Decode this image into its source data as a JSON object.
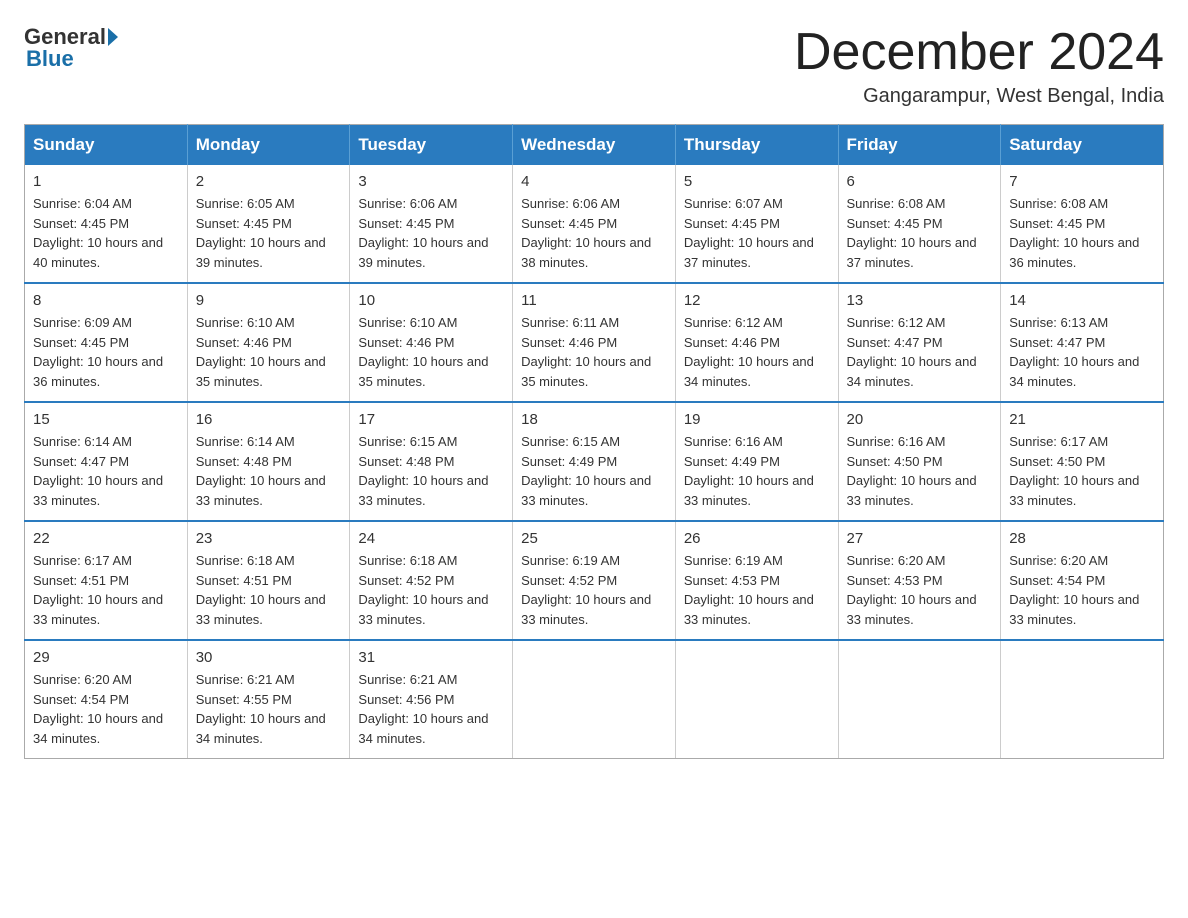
{
  "logo": {
    "general": "General",
    "blue": "Blue",
    "arrow": "▶"
  },
  "header": {
    "title": "December 2024",
    "location": "Gangarampur, West Bengal, India"
  },
  "days": [
    "Sunday",
    "Monday",
    "Tuesday",
    "Wednesday",
    "Thursday",
    "Friday",
    "Saturday"
  ],
  "weeks": [
    [
      {
        "num": "1",
        "sunrise": "6:04 AM",
        "sunset": "4:45 PM",
        "daylight": "10 hours and 40 minutes."
      },
      {
        "num": "2",
        "sunrise": "6:05 AM",
        "sunset": "4:45 PM",
        "daylight": "10 hours and 39 minutes."
      },
      {
        "num": "3",
        "sunrise": "6:06 AM",
        "sunset": "4:45 PM",
        "daylight": "10 hours and 39 minutes."
      },
      {
        "num": "4",
        "sunrise": "6:06 AM",
        "sunset": "4:45 PM",
        "daylight": "10 hours and 38 minutes."
      },
      {
        "num": "5",
        "sunrise": "6:07 AM",
        "sunset": "4:45 PM",
        "daylight": "10 hours and 37 minutes."
      },
      {
        "num": "6",
        "sunrise": "6:08 AM",
        "sunset": "4:45 PM",
        "daylight": "10 hours and 37 minutes."
      },
      {
        "num": "7",
        "sunrise": "6:08 AM",
        "sunset": "4:45 PM",
        "daylight": "10 hours and 36 minutes."
      }
    ],
    [
      {
        "num": "8",
        "sunrise": "6:09 AM",
        "sunset": "4:45 PM",
        "daylight": "10 hours and 36 minutes."
      },
      {
        "num": "9",
        "sunrise": "6:10 AM",
        "sunset": "4:46 PM",
        "daylight": "10 hours and 35 minutes."
      },
      {
        "num": "10",
        "sunrise": "6:10 AM",
        "sunset": "4:46 PM",
        "daylight": "10 hours and 35 minutes."
      },
      {
        "num": "11",
        "sunrise": "6:11 AM",
        "sunset": "4:46 PM",
        "daylight": "10 hours and 35 minutes."
      },
      {
        "num": "12",
        "sunrise": "6:12 AM",
        "sunset": "4:46 PM",
        "daylight": "10 hours and 34 minutes."
      },
      {
        "num": "13",
        "sunrise": "6:12 AM",
        "sunset": "4:47 PM",
        "daylight": "10 hours and 34 minutes."
      },
      {
        "num": "14",
        "sunrise": "6:13 AM",
        "sunset": "4:47 PM",
        "daylight": "10 hours and 34 minutes."
      }
    ],
    [
      {
        "num": "15",
        "sunrise": "6:14 AM",
        "sunset": "4:47 PM",
        "daylight": "10 hours and 33 minutes."
      },
      {
        "num": "16",
        "sunrise": "6:14 AM",
        "sunset": "4:48 PM",
        "daylight": "10 hours and 33 minutes."
      },
      {
        "num": "17",
        "sunrise": "6:15 AM",
        "sunset": "4:48 PM",
        "daylight": "10 hours and 33 minutes."
      },
      {
        "num": "18",
        "sunrise": "6:15 AM",
        "sunset": "4:49 PM",
        "daylight": "10 hours and 33 minutes."
      },
      {
        "num": "19",
        "sunrise": "6:16 AM",
        "sunset": "4:49 PM",
        "daylight": "10 hours and 33 minutes."
      },
      {
        "num": "20",
        "sunrise": "6:16 AM",
        "sunset": "4:50 PM",
        "daylight": "10 hours and 33 minutes."
      },
      {
        "num": "21",
        "sunrise": "6:17 AM",
        "sunset": "4:50 PM",
        "daylight": "10 hours and 33 minutes."
      }
    ],
    [
      {
        "num": "22",
        "sunrise": "6:17 AM",
        "sunset": "4:51 PM",
        "daylight": "10 hours and 33 minutes."
      },
      {
        "num": "23",
        "sunrise": "6:18 AM",
        "sunset": "4:51 PM",
        "daylight": "10 hours and 33 minutes."
      },
      {
        "num": "24",
        "sunrise": "6:18 AM",
        "sunset": "4:52 PM",
        "daylight": "10 hours and 33 minutes."
      },
      {
        "num": "25",
        "sunrise": "6:19 AM",
        "sunset": "4:52 PM",
        "daylight": "10 hours and 33 minutes."
      },
      {
        "num": "26",
        "sunrise": "6:19 AM",
        "sunset": "4:53 PM",
        "daylight": "10 hours and 33 minutes."
      },
      {
        "num": "27",
        "sunrise": "6:20 AM",
        "sunset": "4:53 PM",
        "daylight": "10 hours and 33 minutes."
      },
      {
        "num": "28",
        "sunrise": "6:20 AM",
        "sunset": "4:54 PM",
        "daylight": "10 hours and 33 minutes."
      }
    ],
    [
      {
        "num": "29",
        "sunrise": "6:20 AM",
        "sunset": "4:54 PM",
        "daylight": "10 hours and 34 minutes."
      },
      {
        "num": "30",
        "sunrise": "6:21 AM",
        "sunset": "4:55 PM",
        "daylight": "10 hours and 34 minutes."
      },
      {
        "num": "31",
        "sunrise": "6:21 AM",
        "sunset": "4:56 PM",
        "daylight": "10 hours and 34 minutes."
      },
      null,
      null,
      null,
      null
    ]
  ]
}
